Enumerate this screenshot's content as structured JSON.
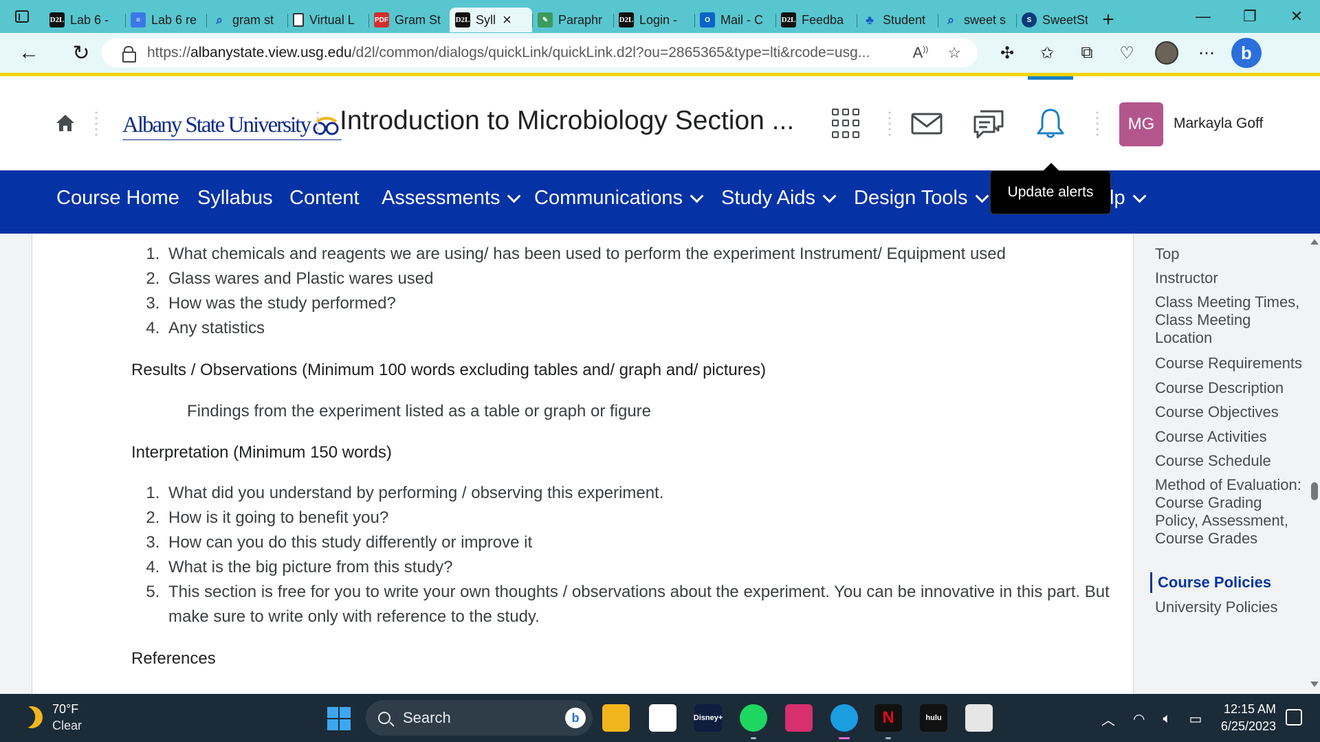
{
  "browser": {
    "tabs": [
      {
        "label": "Lab 6 -",
        "icon": "d2l-icon",
        "favtext": "D2L",
        "active": false
      },
      {
        "label": "Lab 6 re",
        "icon": "docs-icon",
        "favtext": "≡",
        "active": false
      },
      {
        "label": "gram st",
        "icon": "search-icon",
        "favtext": "⌕",
        "active": false
      },
      {
        "label": "Virtual L",
        "icon": "page-icon",
        "favtext": "",
        "active": false
      },
      {
        "label": "Gram St",
        "icon": "pdf-icon",
        "favtext": "PDF",
        "active": false
      },
      {
        "label": "Syll",
        "icon": "d2l-icon",
        "favtext": "D2L",
        "active": true
      },
      {
        "label": "Paraphr",
        "icon": "paraphrase-icon",
        "favtext": "✎",
        "active": false
      },
      {
        "label": "Login -",
        "icon": "d2l-icon",
        "favtext": "D2L",
        "active": false
      },
      {
        "label": "Mail - C",
        "icon": "outlook-icon",
        "favtext": "O",
        "active": false
      },
      {
        "label": "Feedba",
        "icon": "d2l-icon",
        "favtext": "D2L",
        "active": false
      },
      {
        "label": "Student",
        "icon": "student-icon",
        "favtext": "♣",
        "active": false
      },
      {
        "label": "sweet s",
        "icon": "search-icon",
        "favtext": "⌕",
        "active": false
      },
      {
        "label": "SweetSt",
        "icon": "sweetstudy-icon",
        "favtext": "S",
        "active": false
      }
    ],
    "url_prefix": "https://",
    "url_host": "albanystate.view.usg.edu",
    "url_path": "/d2l/common/dialogs/quickLink/quickLink.d2l?ou=2865365&type=lti&rcode=usg..."
  },
  "header": {
    "logo_text": "Albany State University",
    "course_title": "Introduction to Microbiology Section ...",
    "user_initials": "MG",
    "user_name": "Markayla Goff",
    "tooltip": "Update alerts"
  },
  "nav": {
    "items": [
      {
        "label": "Course Home",
        "dropdown": false
      },
      {
        "label": "Syllabus",
        "dropdown": false
      },
      {
        "label": "Content",
        "dropdown": false
      },
      {
        "label": "Assessments",
        "dropdown": true
      },
      {
        "label": "Communications",
        "dropdown": true
      },
      {
        "label": "Study Aids",
        "dropdown": true
      },
      {
        "label": "Design Tools",
        "dropdown": true
      },
      {
        "label": "lp",
        "dropdown": true
      }
    ]
  },
  "content": {
    "list1": [
      "What chemicals and reagents we are using/ has been used to perform the experiment Instrument/ Equipment used",
      "Glass wares and Plastic wares used",
      "How was the study performed?",
      "Any statistics"
    ],
    "results_heading": "Results / Observations (Minimum 100 words excluding tables and/ graph and/ pictures)",
    "findings": "Findings from the experiment listed as a table or graph or figure",
    "interpretation_heading": "Interpretation (Minimum 150 words)",
    "list2": [
      "What did you understand by performing / observing this experiment.",
      "How is it going to benefit you?",
      "How can you do this study differently or improve it",
      "What is the big picture from this study?",
      "This section is free for you to write your own thoughts / observations about the experiment. You can be innovative in this part. But make sure to write only with reference to the study."
    ],
    "references_heading": "References"
  },
  "toc": {
    "items": [
      {
        "label": "Top",
        "active": false
      },
      {
        "label": "Instructor",
        "active": false
      },
      {
        "label": "Class Meeting Times, Class Meeting Location",
        "active": false
      },
      {
        "label": "Course Requirements",
        "active": false
      },
      {
        "label": "Course Description",
        "active": false
      },
      {
        "label": "Course Objectives",
        "active": false
      },
      {
        "label": "Course Activities",
        "active": false
      },
      {
        "label": "Course Schedule",
        "active": false
      },
      {
        "label": "Method of Evaluation: Course Grading Policy, Assessment, Course Grades",
        "active": false
      },
      {
        "label": "Course Policies",
        "active": true
      },
      {
        "label": "University Policies",
        "active": false
      }
    ]
  },
  "taskbar": {
    "temperature": "70°F",
    "condition": "Clear",
    "search_label": "Search",
    "time": "12:15 AM",
    "date": "6/25/2023",
    "apps": [
      {
        "name": "file-explorer-icon",
        "color": "#f2b61c",
        "text": ""
      },
      {
        "name": "microsoft-store-icon",
        "color": "#ffffff",
        "text": ""
      },
      {
        "name": "disney-plus-icon",
        "color": "#0f1d3f",
        "text": "Disney+"
      },
      {
        "name": "spotify-icon",
        "color": "#1ed760",
        "text": ""
      },
      {
        "name": "instagram-icon",
        "color": "#d6306f",
        "text": ""
      },
      {
        "name": "edge-icon",
        "color": "#1b9de2",
        "text": ""
      },
      {
        "name": "netflix-icon",
        "color": "#111111",
        "text": "N"
      },
      {
        "name": "hulu-icon",
        "color": "#111111",
        "text": "hulu"
      },
      {
        "name": "roblox-icon",
        "color": "#e6e6e6",
        "text": ""
      }
    ]
  },
  "colors": {
    "nav_bg": "#0532a5",
    "tab_strip": "#58c6cf",
    "avatar": "#b3568e",
    "toc_active": "#0532a5"
  }
}
